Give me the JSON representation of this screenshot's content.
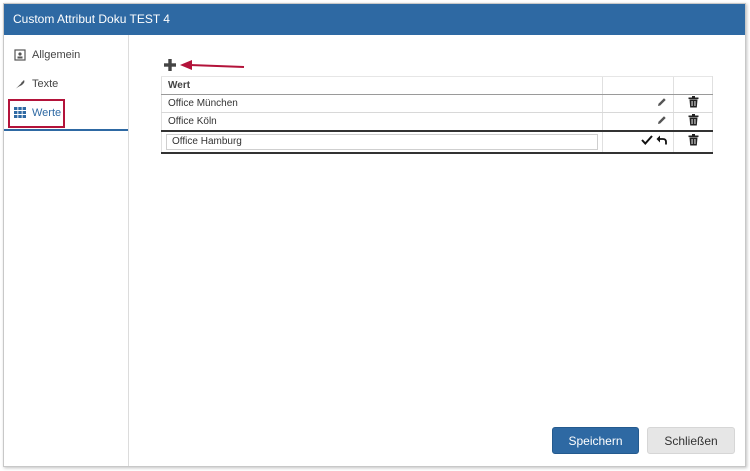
{
  "dialog": {
    "title": "Custom Attribut Doku TEST 4"
  },
  "sidebar": {
    "items": [
      {
        "label": "Allgemein",
        "icon": "id-card-icon"
      },
      {
        "label": "Texte",
        "icon": "feather-icon"
      },
      {
        "label": "Werte",
        "icon": "grid-icon",
        "active": true
      }
    ]
  },
  "table": {
    "header": "Wert",
    "rows": [
      {
        "value": "Office München"
      },
      {
        "value": "Office Köln"
      }
    ],
    "edit_row": {
      "value": "Office Hamburg"
    }
  },
  "footer": {
    "save_label": "Speichern",
    "close_label": "Schließen"
  },
  "colors": {
    "accent": "#2e69a3",
    "annotation": "#b3133a"
  }
}
